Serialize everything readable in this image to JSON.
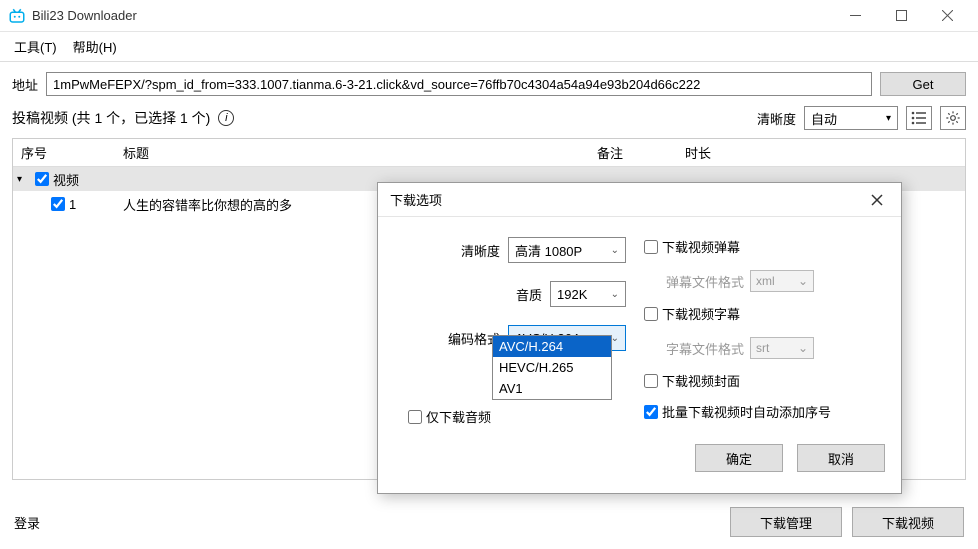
{
  "titlebar": {
    "title": "Bili23 Downloader"
  },
  "menu": {
    "tools": "工具(T)",
    "help": "帮助(H)"
  },
  "addr": {
    "label": "地址",
    "value": "1mPwMeFEPX/?spm_id_from=333.1007.tianma.6-3-21.click&vd_source=76ffb70c4304a54a94e93b204d66c222",
    "get": "Get"
  },
  "summary": {
    "text": "投稿视频 (共 1 个，已选择 1 个)",
    "clarity_label": "清晰度",
    "clarity_value": "自动"
  },
  "list": {
    "headers": {
      "idx": "序号",
      "title": "标题",
      "note": "备注",
      "dur": "时长"
    },
    "group": "视频",
    "rows": [
      {
        "idx": "1",
        "title": "人生的容错率比你想的高的多"
      }
    ]
  },
  "footer": {
    "login": "登录",
    "manage": "下载管理",
    "download": "下载视频"
  },
  "dialog": {
    "title": "下载选项",
    "clarity_label": "清晰度",
    "clarity_value": "高清 1080P",
    "audio_label": "音质",
    "audio_value": "192K",
    "codec_label": "编码格式",
    "codec_value": "AVC/H.264",
    "codec_options": [
      "AVC/H.264",
      "HEVC/H.265",
      "AV1"
    ],
    "only_download_label": "仅下载音频",
    "dl_danmaku": "下载视频弹幕",
    "danmaku_format_label": "弹幕文件格式",
    "danmaku_format": "xml",
    "dl_subtitle": "下载视频字幕",
    "subtitle_format_label": "字幕文件格式",
    "subtitle_format": "srt",
    "dl_cover": "下载视频封面",
    "auto_index": "批量下载视频时自动添加序号",
    "ok": "确定",
    "cancel": "取消"
  }
}
